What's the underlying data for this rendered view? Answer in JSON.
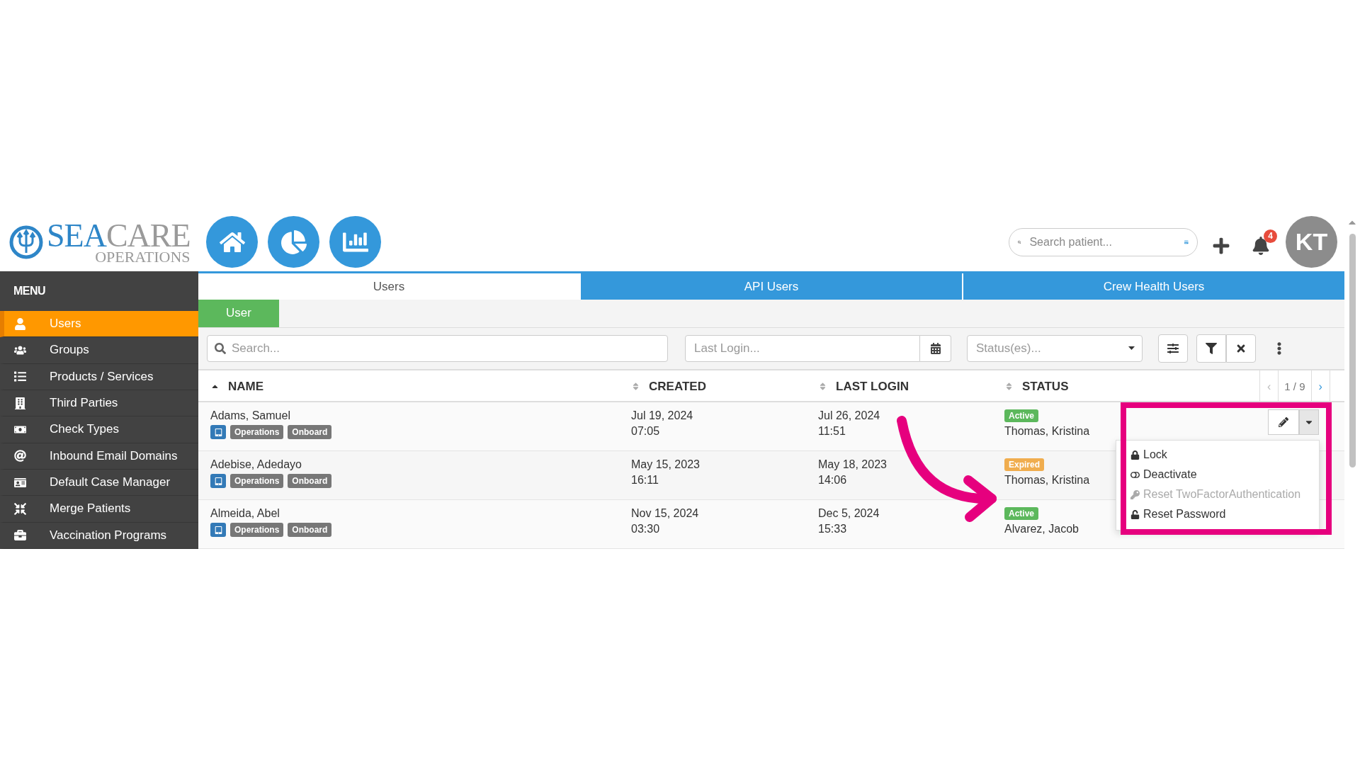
{
  "logo": {
    "word_1": "SEA",
    "word_2": "CARE",
    "subtitle": "OPERATIONS"
  },
  "top_bar": {
    "search": {
      "placeholder": "Search patient..."
    },
    "notifications": {
      "count": "4"
    },
    "avatar": {
      "initials": "KT"
    }
  },
  "sidebar": {
    "title": "MENU",
    "items": [
      {
        "label": "Users",
        "selected": true
      },
      {
        "label": "Groups",
        "selected": false
      },
      {
        "label": "Products / Services",
        "selected": false
      },
      {
        "label": "Third Parties",
        "selected": false
      },
      {
        "label": "Check Types",
        "selected": false
      },
      {
        "label": "Inbound Email Domains",
        "selected": false
      },
      {
        "label": "Default Case Manager",
        "selected": false
      },
      {
        "label": "Merge Patients",
        "selected": false
      },
      {
        "label": "Vaccination Programs",
        "selected": false
      }
    ]
  },
  "tabs": [
    {
      "label": "Users",
      "selected": true
    },
    {
      "label": "API Users",
      "selected": false
    },
    {
      "label": "Crew Health Users",
      "selected": false
    }
  ],
  "sub_tabs": [
    {
      "label": "User",
      "selected": true
    }
  ],
  "filters": {
    "search": {
      "placeholder": "Search..."
    },
    "last_login": {
      "placeholder": "Last Login..."
    },
    "status": {
      "placeholder": "Status(es)..."
    }
  },
  "table": {
    "columns": [
      {
        "label": "NAME",
        "sorted": true
      },
      {
        "label": "CREATED",
        "sorted": false
      },
      {
        "label": "LAST LOGIN",
        "sorted": false
      },
      {
        "label": "STATUS",
        "sorted": false
      }
    ],
    "pagination": {
      "prev": "‹",
      "page": "1 / 9",
      "next": "›"
    },
    "rows": [
      {
        "name": "Adams, Samuel",
        "tags": [
          "Operations",
          "Onboard"
        ],
        "created": [
          "Jul 19, 2024",
          "07:05"
        ],
        "last_login": [
          "Jul 26, 2024",
          "11:51"
        ],
        "status": {
          "label": "Active",
          "color": "#5cb85c"
        },
        "manager": "Thomas, Kristina",
        "actions": true
      },
      {
        "name": "Adebise, Adedayo",
        "tags": [
          "Operations",
          "Onboard"
        ],
        "created": [
          "May 15, 2023",
          "16:11"
        ],
        "last_login": [
          "May 18, 2023",
          "14:06"
        ],
        "status": {
          "label": "Expired",
          "color": "#f0ad4e"
        },
        "manager": "Thomas, Kristina",
        "actions": false
      },
      {
        "name": "Almeida, Abel",
        "tags": [
          "Operations",
          "Onboard"
        ],
        "created": [
          "Nov 15, 2024",
          "03:30"
        ],
        "last_login": [
          "Dec 5, 2024",
          "15:33"
        ],
        "status": {
          "label": "Active",
          "color": "#5cb85c"
        },
        "manager": "Alvarez, Jacob",
        "actions": false
      }
    ]
  },
  "dropdown_menu": {
    "items": [
      {
        "label": "Lock",
        "disabled": false
      },
      {
        "label": "Deactivate",
        "disabled": false
      },
      {
        "label": "Reset TwoFactorAuthentication",
        "disabled": true
      },
      {
        "label": "Reset Password",
        "disabled": false
      }
    ]
  }
}
